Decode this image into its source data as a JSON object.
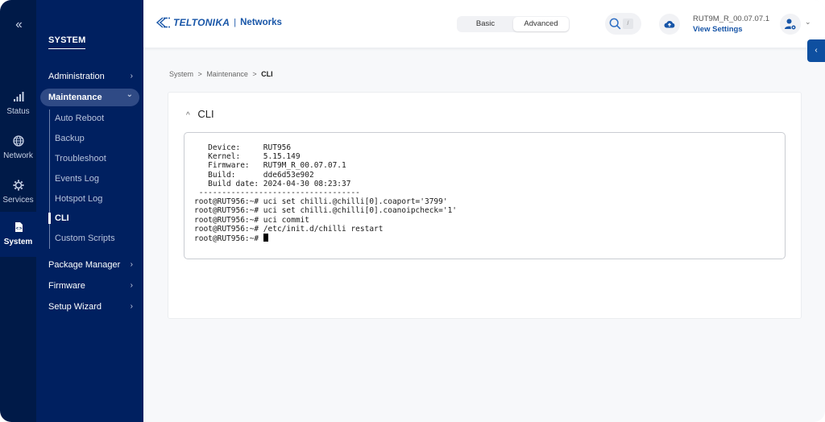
{
  "rail": {
    "collapse_icon": "double-chevron-left-icon",
    "items": [
      {
        "label": "Status",
        "icon": "signal-bars-icon"
      },
      {
        "label": "Network",
        "icon": "globe-icon"
      },
      {
        "label": "Services",
        "icon": "gear-icon"
      },
      {
        "label": "System",
        "icon": "system-file-icon",
        "active": true
      }
    ]
  },
  "subnav": {
    "title": "SYSTEM",
    "items": [
      {
        "label": "Administration",
        "chevron": "›"
      },
      {
        "label": "Maintenance",
        "chevron": "⌄",
        "expanded": true
      },
      {
        "label": "Package Manager",
        "chevron": "›"
      },
      {
        "label": "Firmware",
        "chevron": "›"
      },
      {
        "label": "Setup Wizard",
        "chevron": "›"
      }
    ],
    "maintenance_children": [
      {
        "label": "Auto Reboot"
      },
      {
        "label": "Backup"
      },
      {
        "label": "Troubleshoot"
      },
      {
        "label": "Events Log"
      },
      {
        "label": "Hotspot Log"
      },
      {
        "label": "CLI",
        "active": true
      },
      {
        "label": "Custom Scripts"
      }
    ]
  },
  "header": {
    "brand": "TELTONIKA",
    "separator": "|",
    "brand_sub": "Networks",
    "modes": [
      {
        "label": "Basic"
      },
      {
        "label": "Advanced",
        "active": true
      }
    ],
    "search_shortcut": "/",
    "firmware_version": "RUT9M_R_00.07.07.1",
    "view_settings": "View Settings",
    "user_chevron": "⌄",
    "side_tab_icon": "‹"
  },
  "breadcrumb": [
    {
      "label": "System"
    },
    {
      "label": "Maintenance"
    },
    {
      "label": "CLI",
      "current": true
    }
  ],
  "breadcrumb_sep": ">",
  "card": {
    "caret": "^",
    "title": "CLI"
  },
  "terminal": {
    "lines": [
      "   Device:     RUT956",
      "   Kernel:     5.15.149",
      "   Firmware:   RUT9M_R_00.07.07.1",
      "   Build:      dde6d53e902",
      "   Build date: 2024-04-30 08:23:37",
      " -----------------------------------",
      "root@RUT956:~# uci set chilli.@chilli[0].coaport='3799'",
      "root@RUT956:~# uci set chilli.@chilli[0].coanoipcheck='1'",
      "root@RUT956:~# uci commit",
      "root@RUT956:~# /etc/init.d/chilli restart"
    ],
    "prompt": "root@RUT956:~# "
  },
  "colors": {
    "rail_bg": "#001a48",
    "nav_bg": "#002060",
    "accent": "#1856a8",
    "side_tab": "#0e4fa0"
  }
}
